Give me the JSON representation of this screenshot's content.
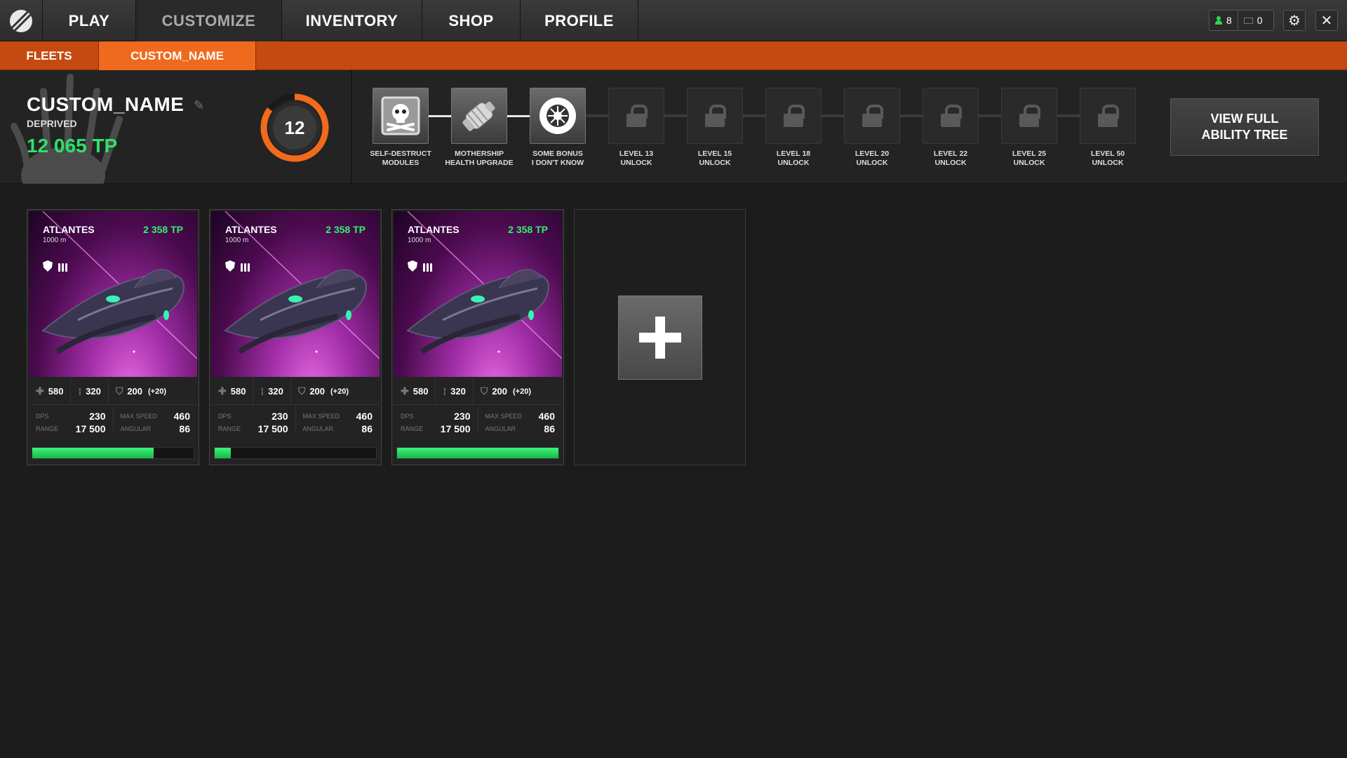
{
  "nav": {
    "logo_icon": "game-logo-icon",
    "tabs": [
      {
        "label": "PLAY",
        "active": false
      },
      {
        "label": "CUSTOMIZE",
        "active": true
      },
      {
        "label": "INVENTORY",
        "active": false
      },
      {
        "label": "SHOP",
        "active": false
      },
      {
        "label": "PROFILE",
        "active": false
      }
    ],
    "friends_online": "8",
    "messages": "0",
    "settings_icon": "gear-icon",
    "close_icon": "close-icon"
  },
  "subnav": {
    "tabs": [
      {
        "label": "FLEETS",
        "active": false
      },
      {
        "label": "CUSTOM_NAME",
        "active": true
      }
    ]
  },
  "fleet": {
    "name": "CUSTOM_NAME",
    "subtitle": "DEPRIVED",
    "tp": "12 065  TP",
    "level": "12",
    "level_progress": 0.85,
    "accent_color": "#f26a1c",
    "tp_color": "#2fe06a"
  },
  "abilities": [
    {
      "label_1": "SELF-DESTRUCT",
      "label_2": "MODULES",
      "unlocked": true,
      "icon": "skull-crossbones-icon"
    },
    {
      "label_1": "MOTHERSHIP",
      "label_2": "HEALTH UPGRADE",
      "unlocked": true,
      "icon": "engine-module-icon"
    },
    {
      "label_1": "SOME BONUS",
      "label_2": "I DON'T KNOW",
      "unlocked": true,
      "icon": "starburst-icon"
    },
    {
      "label_1": "LEVEL 13",
      "label_2": "UNLOCK",
      "unlocked": false,
      "icon": "lock-icon"
    },
    {
      "label_1": "LEVEL 15",
      "label_2": "UNLOCK",
      "unlocked": false,
      "icon": "lock-icon"
    },
    {
      "label_1": "LEVEL 18",
      "label_2": "UNLOCK",
      "unlocked": false,
      "icon": "lock-icon"
    },
    {
      "label_1": "LEVEL 20",
      "label_2": "UNLOCK",
      "unlocked": false,
      "icon": "lock-icon"
    },
    {
      "label_1": "LEVEL 22",
      "label_2": "UNLOCK",
      "unlocked": false,
      "icon": "lock-icon"
    },
    {
      "label_1": "LEVEL 25",
      "label_2": "UNLOCK",
      "unlocked": false,
      "icon": "lock-icon"
    },
    {
      "label_1": "LEVEL 50",
      "label_2": "UNLOCK",
      "unlocked": false,
      "icon": "lock-icon"
    }
  ],
  "view_full": {
    "line1": "VIEW FULL",
    "line2": "ABILITY TREE"
  },
  "ships": [
    {
      "name": "ATLANTES",
      "distance": "1000 m",
      "tp": "2 358 TP",
      "health": "580",
      "ammo": "320",
      "shield": "200",
      "shield_bonus": "(+20)",
      "dps_label": "DPS",
      "dps": "230",
      "range_label": "RANGE",
      "range": "17 500",
      "speed_label": "MAX SPEED",
      "speed": "460",
      "angular_label": "ANGULAR",
      "angular": "86",
      "progress": 0.75
    },
    {
      "name": "ATLANTES",
      "distance": "1000 m",
      "tp": "2 358 TP",
      "health": "580",
      "ammo": "320",
      "shield": "200",
      "shield_bonus": "(+20)",
      "dps_label": "DPS",
      "dps": "230",
      "range_label": "RANGE",
      "range": "17 500",
      "speed_label": "MAX SPEED",
      "speed": "460",
      "angular_label": "ANGULAR",
      "angular": "86",
      "progress": 0.1
    },
    {
      "name": "ATLANTES",
      "distance": "1000 m",
      "tp": "2 358 TP",
      "health": "580",
      "ammo": "320",
      "shield": "200",
      "shield_bonus": "(+20)",
      "dps_label": "DPS",
      "dps": "230",
      "range_label": "RANGE",
      "range": "17 500",
      "speed_label": "MAX SPEED",
      "speed": "460",
      "angular_label": "ANGULAR",
      "angular": "86",
      "progress": 1.0
    }
  ],
  "add_ship": {
    "icon": "plus-icon"
  }
}
